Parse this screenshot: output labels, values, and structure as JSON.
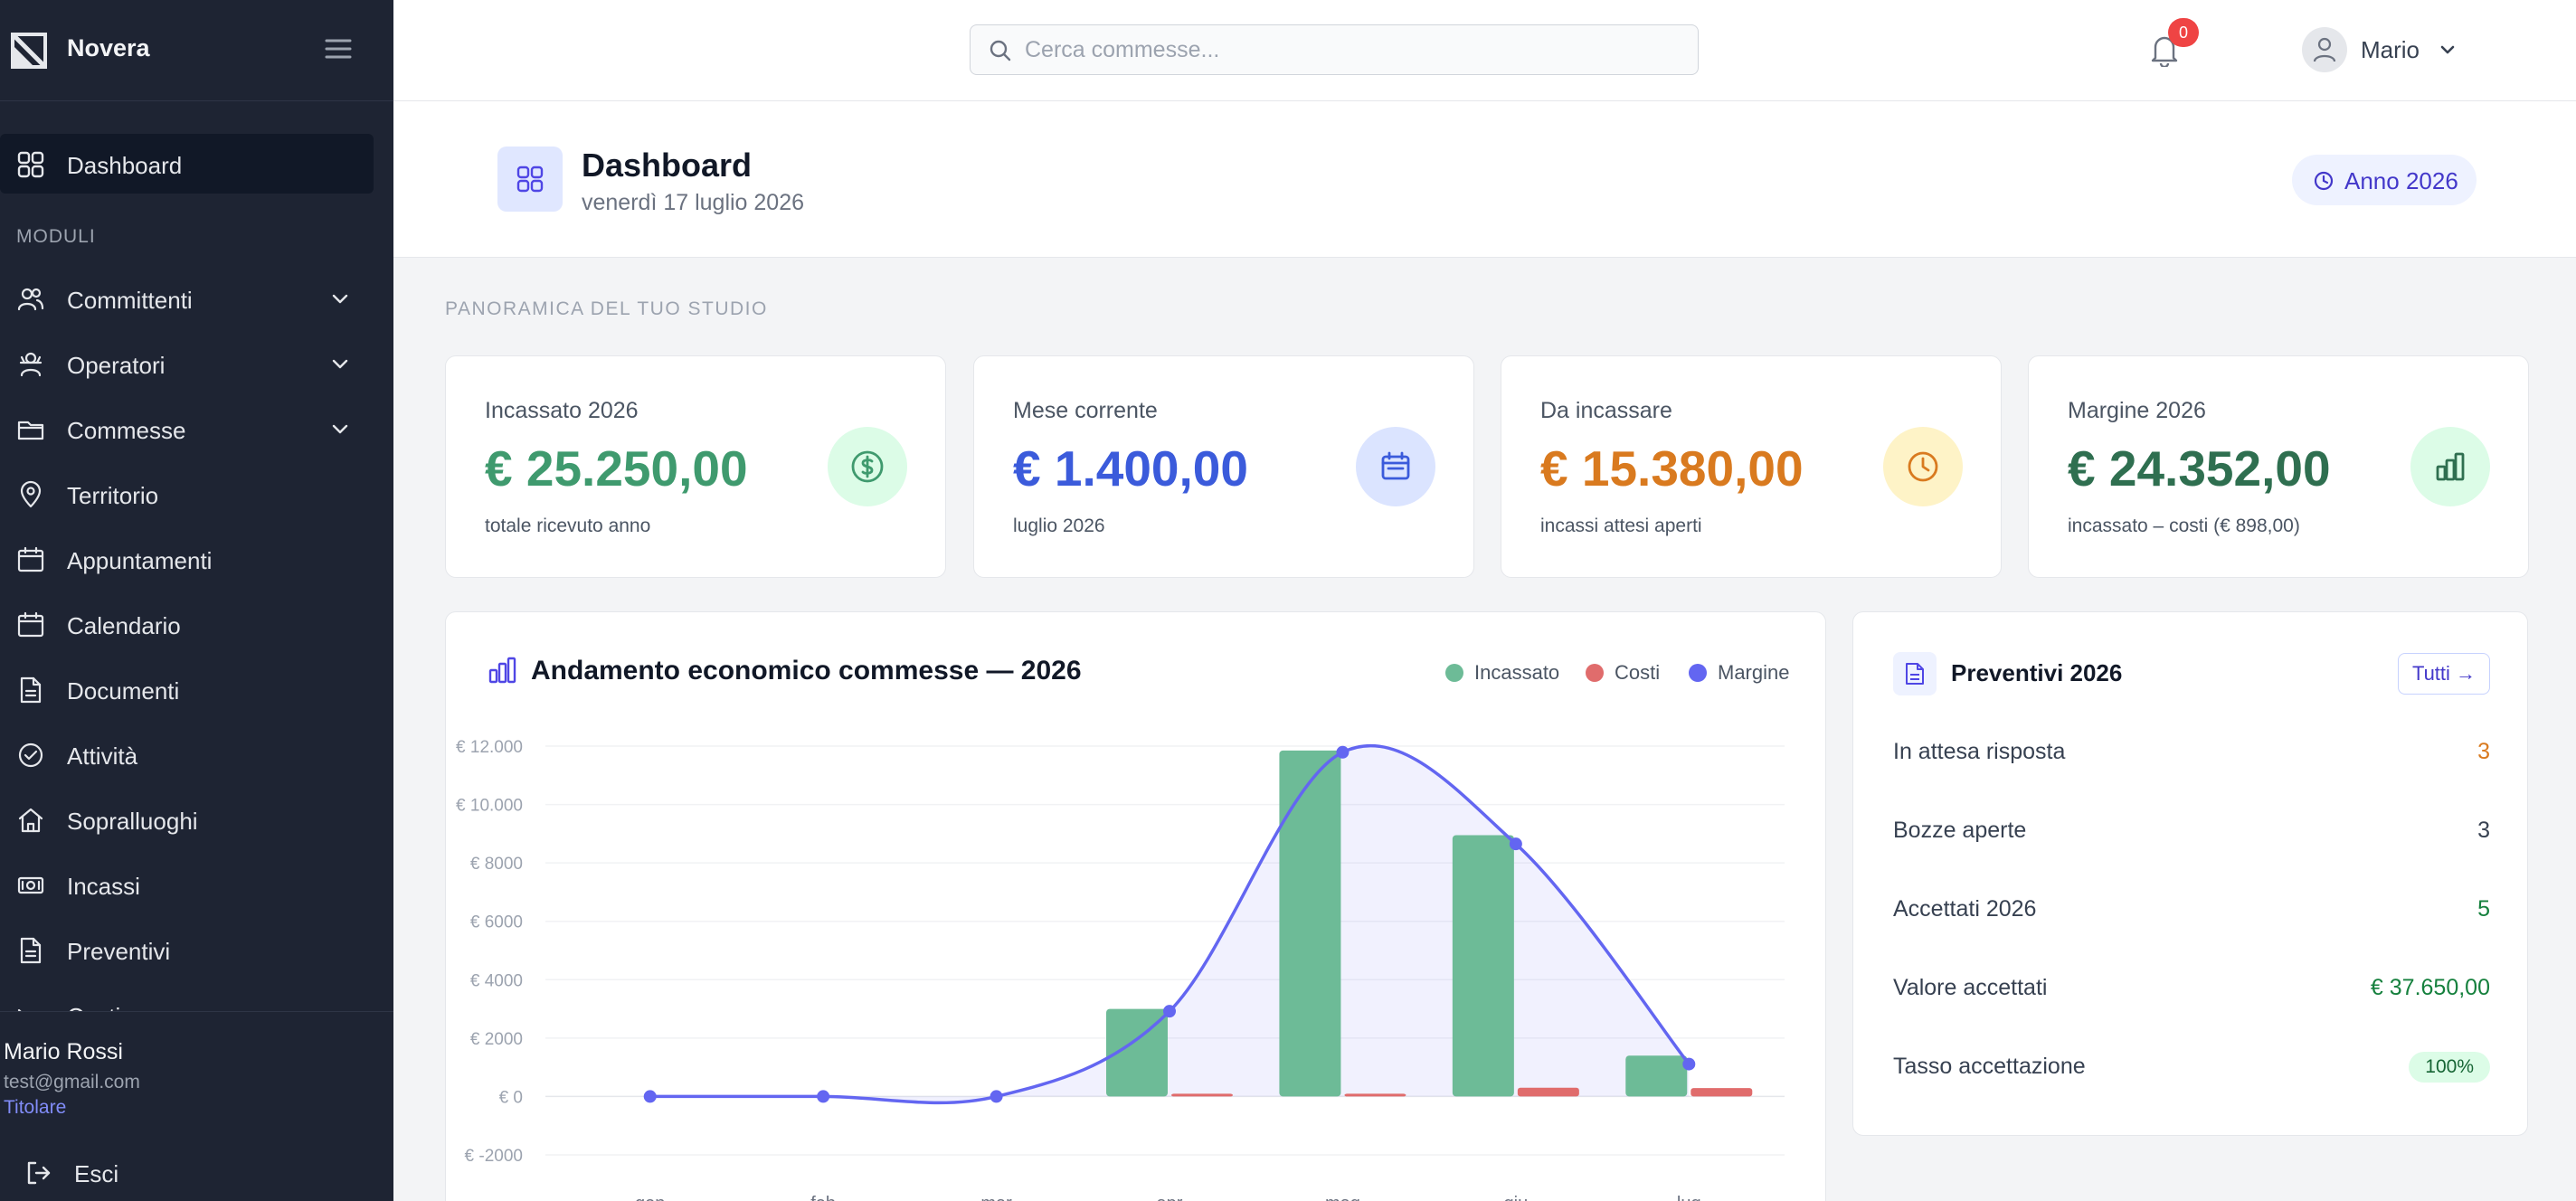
{
  "app": {
    "name": "Novera"
  },
  "sidebar": {
    "section_label": "MODULI",
    "dashboard_label": "Dashboard",
    "items": [
      {
        "label": "Committenti",
        "icon": "users-icon",
        "expandable": true
      },
      {
        "label": "Operatori",
        "icon": "operator-icon",
        "expandable": true
      },
      {
        "label": "Commesse",
        "icon": "folder-icon",
        "expandable": true
      },
      {
        "label": "Territorio",
        "icon": "map-pin-icon",
        "expandable": false
      },
      {
        "label": "Appuntamenti",
        "icon": "calendar-icon",
        "expandable": false
      },
      {
        "label": "Calendario",
        "icon": "calendar-icon",
        "expandable": false
      },
      {
        "label": "Documenti",
        "icon": "document-icon",
        "expandable": false
      },
      {
        "label": "Attività",
        "icon": "check-circle-icon",
        "expandable": false
      },
      {
        "label": "Sopralluoghi",
        "icon": "home-icon",
        "expandable": false
      },
      {
        "label": "Incassi",
        "icon": "cash-icon",
        "expandable": false
      },
      {
        "label": "Preventivi",
        "icon": "document-icon",
        "expandable": false
      },
      {
        "label": "Costi",
        "icon": "trend-down-icon",
        "expandable": false
      }
    ],
    "user": {
      "name": "Mario Rossi",
      "email": "test@gmail.com",
      "role": "Titolare"
    },
    "logout_label": "Esci"
  },
  "topbar": {
    "search_placeholder": "Cerca commesse...",
    "notifications_count": "0",
    "user_name": "Mario"
  },
  "page": {
    "title": "Dashboard",
    "date": "venerdì 17 luglio 2026",
    "year_button": "Anno 2026",
    "overview_label": "PANORAMICA DEL TUO STUDIO"
  },
  "kpis": [
    {
      "label": "Incassato 2026",
      "value": "€ 25.250,00",
      "sub": "totale ricevuto anno",
      "color": "#3f9a6e",
      "icon_bg": "#dcfce7",
      "icon": "dollar-icon"
    },
    {
      "label": "Mese corrente",
      "value": "€ 1.400,00",
      "sub": "luglio 2026",
      "color": "#3b5bdb",
      "icon_bg": "#dbe4ff",
      "icon": "calendar-icon"
    },
    {
      "label": "Da incassare",
      "value": "€ 15.380,00",
      "sub": "incassi attesi aperti",
      "color": "#d97a1f",
      "icon_bg": "#fef3c7",
      "icon": "clock-icon"
    },
    {
      "label": "Margine 2026",
      "value": "€ 24.352,00",
      "sub": "incassato – costi (€ 898,00)",
      "color": "#2f6f50",
      "icon_bg": "#dcfce7",
      "icon": "bar-chart-icon"
    }
  ],
  "chart_data": {
    "type": "bar",
    "title": "Andamento economico commesse — 2026",
    "categories": [
      "gen",
      "feb",
      "mar",
      "apr",
      "mag",
      "giu",
      "lug"
    ],
    "ylim": [
      -2000,
      12000
    ],
    "yticks": [
      -2000,
      0,
      2000,
      4000,
      6000,
      8000,
      10000,
      12000
    ],
    "ytick_labels": [
      "€ -2000",
      "€ 0",
      "€ 2000",
      "€ 4000",
      "€ 6000",
      "€ 8000",
      "€ 10.000",
      "€ 12.000"
    ],
    "grid": true,
    "legend_position": "top-right",
    "series": [
      {
        "name": "Incassato",
        "type": "bar",
        "color": "#6dbb97",
        "values": [
          0,
          0,
          0,
          3000,
          11850,
          8950,
          1400
        ]
      },
      {
        "name": "Costi",
        "type": "bar",
        "color": "#e06c6c",
        "values": [
          0,
          0,
          0,
          80,
          60,
          300,
          290
        ]
      },
      {
        "name": "Margine",
        "type": "line",
        "color": "#6366f1",
        "values": [
          0,
          0,
          0,
          2920,
          11790,
          8650,
          1110
        ]
      }
    ]
  },
  "quotes": {
    "title": "Preventivi 2026",
    "all_button": "Tutti →",
    "rows": [
      {
        "label": "In attesa risposta",
        "value": "3",
        "color": "#d97a1f"
      },
      {
        "label": "Bozze aperte",
        "value": "3",
        "color": "#374151"
      },
      {
        "label": "Accettati 2026",
        "value": "5",
        "color": "#15803d"
      },
      {
        "label": "Valore accettati",
        "value": "€ 37.650,00",
        "color": "#15803d"
      }
    ],
    "rate_label": "Tasso accettazione",
    "rate_value": "100%"
  }
}
